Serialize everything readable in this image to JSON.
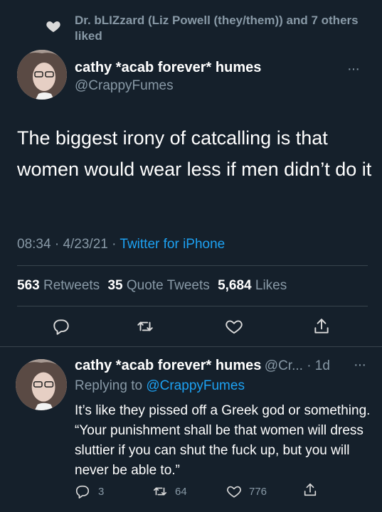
{
  "liked_by": {
    "text": "Dr. bLIZzard (Liz Powell (they/them)) and 7 others liked"
  },
  "main_tweet": {
    "author_name": "cathy *acab forever* humes",
    "handle": "@CrappyFumes",
    "text": "The biggest irony of catcalling is that women would wear less if men didn’t do it",
    "time": "08:34",
    "date": "4/23/21",
    "source": "Twitter for iPhone",
    "retweets_count": "563",
    "retweets_label": "Retweets",
    "quotes_count": "35",
    "quotes_label": "Quote Tweets",
    "likes_count": "5,684",
    "likes_label": "Likes",
    "more_label": "···"
  },
  "reply_tweet": {
    "author_name": "cathy *acab forever* humes",
    "handle_time": "@Cr... · 1d",
    "replying_label": "Replying to",
    "replying_handle": "@CrappyFumes",
    "text": "It’s like they pissed off a Greek god or something. “Your punishment shall be that women will dress sluttier if you can shut the fuck up, but you will never be able to.”",
    "reply_count": "3",
    "retweet_count": "64",
    "like_count": "776",
    "more_label": "···"
  },
  "colors": {
    "background": "#15202b",
    "accent": "#1da1f2",
    "muted": "#8899a6",
    "divider": "#38444d"
  },
  "icons": [
    "heart-icon",
    "reply-icon",
    "retweet-icon",
    "like-icon",
    "share-icon"
  ]
}
